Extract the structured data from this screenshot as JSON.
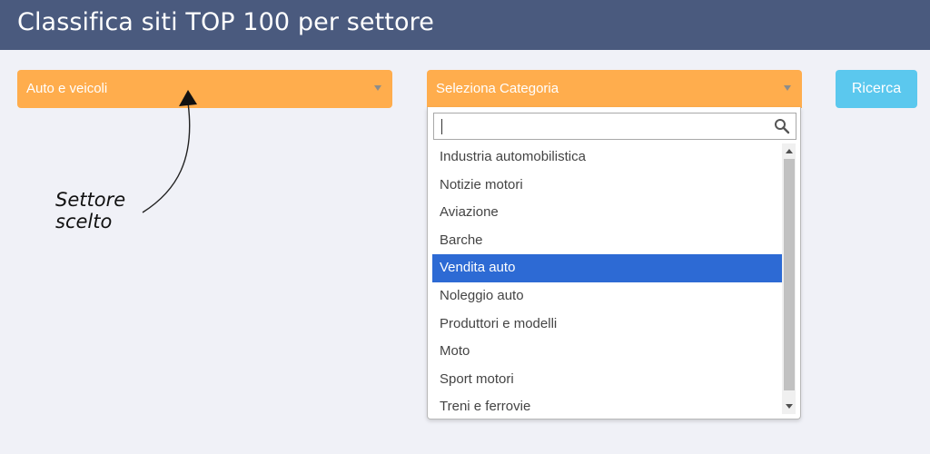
{
  "header": {
    "title": "Classifica siti TOP 100 per settore"
  },
  "sector_select": {
    "value": "Auto e veicoli"
  },
  "category_select": {
    "placeholder": "Seleziona Categoria",
    "search_value": "",
    "options": [
      "Industria automobilistica",
      "Notizie motori",
      "Aviazione",
      "Barche",
      "Vendita auto",
      "Noleggio auto",
      "Produttori e modelli",
      "Moto",
      "Sport motori",
      "Treni e ferrovie"
    ],
    "highlighted_index": 4
  },
  "search_button": {
    "label": "Ricerca"
  },
  "annotation": {
    "line1": "Settore",
    "line2": "scelto"
  },
  "colors": {
    "header_bg": "#4a5a7e",
    "select_bg": "#ffad4d",
    "button_bg": "#5bc8ee",
    "highlight": "#2d6ad4",
    "page_bg": "#f0f1f7"
  },
  "icons": {
    "search": "search-icon",
    "dropdown": "chevron-down-icon"
  }
}
